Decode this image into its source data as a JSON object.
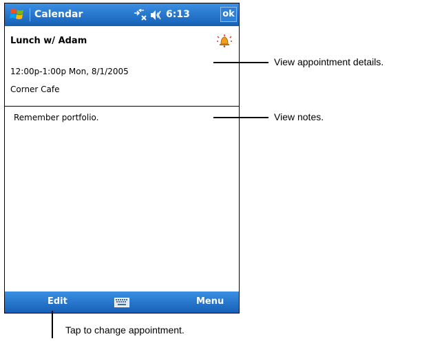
{
  "titlebar": {
    "app_title": "Calendar",
    "clock": "6:13",
    "ok_label": "ok",
    "icons": [
      "windows-start-icon",
      "connectivity-icon",
      "volume-icon"
    ]
  },
  "appointment": {
    "title": "Lunch w/ Adam",
    "time": "12:00p-1:00p Mon, 8/1/2005",
    "location": "Corner Cafe",
    "alarm_icon": "alarm-bell-icon"
  },
  "notes": {
    "text": "Remember portfolio."
  },
  "menubar": {
    "edit_label": "Edit",
    "menu_label": "Menu",
    "input_icon": "keyboard-icon"
  },
  "callouts": {
    "details": "View appointment details.",
    "notes": "View notes.",
    "edit": "Tap to change appointment."
  },
  "colors": {
    "bar_top": "#3b8fe3",
    "bar_bottom": "#1560b6"
  }
}
